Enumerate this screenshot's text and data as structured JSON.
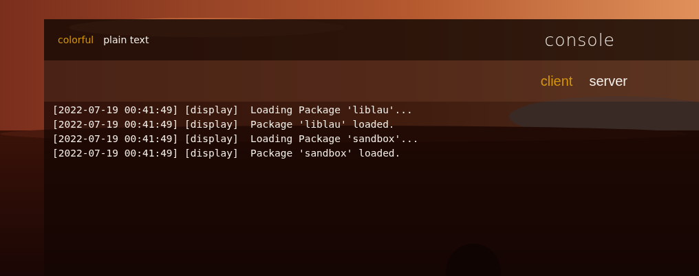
{
  "modes": [
    {
      "label": "colorful",
      "selected": true
    },
    {
      "label": "plain text",
      "selected": false
    }
  ],
  "title": "console",
  "tabs": [
    {
      "label": "client",
      "selected": true
    },
    {
      "label": "server",
      "selected": false
    }
  ],
  "log_lines": [
    "[2022-07-19 00:41:49] [display]  Loading Package 'liblau'...",
    "[2022-07-19 00:41:49] [display]  Package 'liblau' loaded.",
    "[2022-07-19 00:41:49] [display]  Loading Package 'sandbox'...",
    "[2022-07-19 00:41:49] [display]  Package 'sandbox' loaded."
  ]
}
